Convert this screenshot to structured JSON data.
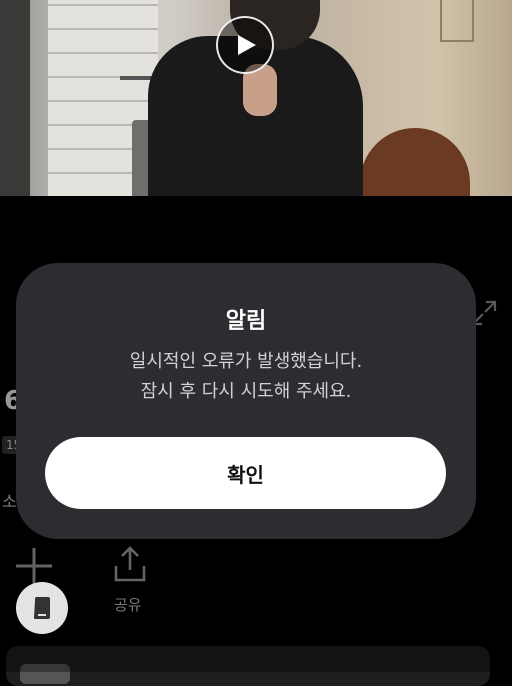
{
  "video": {
    "play_icon": "play-icon"
  },
  "background_page": {
    "count_partial": "6",
    "badge_partial": "15",
    "text_partial": "소",
    "expand_icon": "expand-icon",
    "add_icon": "plus-icon",
    "share_icon": "share-icon",
    "share_label": "공유",
    "floating_button_icon": "mobile-device-icon"
  },
  "dialog": {
    "title": "알림",
    "message_line1": "일시적인 오류가 발생했습니다.",
    "message_line2": "잠시 후 다시 시도해 주세요.",
    "confirm_label": "확인"
  },
  "colors": {
    "background": "#000000",
    "dialog_bg": "#2c2d31",
    "confirm_bg": "#ffffff",
    "confirm_text": "#111111"
  }
}
